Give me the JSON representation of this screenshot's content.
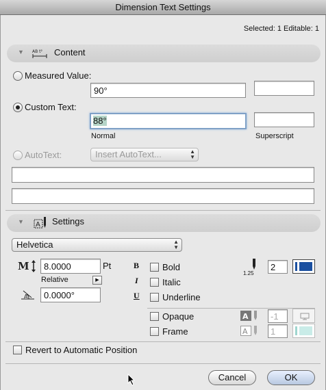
{
  "window": {
    "title": "Dimension Text Settings"
  },
  "selection_info": "Selected: 1 Editable: 1",
  "content": {
    "section_title": "Content",
    "measured_value": {
      "label": "Measured Value:",
      "value": "90°",
      "superscript": ""
    },
    "custom_text": {
      "label": "Custom Text:",
      "value": "88°",
      "superscript": "",
      "normal_caption": "Normal",
      "superscript_caption": "Superscript"
    },
    "autotext": {
      "label": "AutoText:",
      "insert_label": "Insert AutoText..."
    },
    "extra_line_1": "",
    "extra_line_2": ""
  },
  "settings": {
    "section_title": "Settings",
    "font": "Helvetica",
    "size": {
      "value": "8.0000",
      "unit": "Pt",
      "mode": "Relative"
    },
    "angle": "0.0000°",
    "styles": [
      {
        "key": "B",
        "label": "Bold"
      },
      {
        "key": "I",
        "label": "Italic"
      },
      {
        "key": "U",
        "label": "Underline"
      }
    ],
    "pen_caption": "1.25",
    "pen_number": "2",
    "pen_color": "#1a4fa0",
    "opaque": {
      "label": "Opaque",
      "value": "-1"
    },
    "frame": {
      "label": "Frame",
      "value": "1"
    }
  },
  "revert_label": "Revert to Automatic Position",
  "buttons": {
    "cancel": "Cancel",
    "ok": "OK"
  }
}
